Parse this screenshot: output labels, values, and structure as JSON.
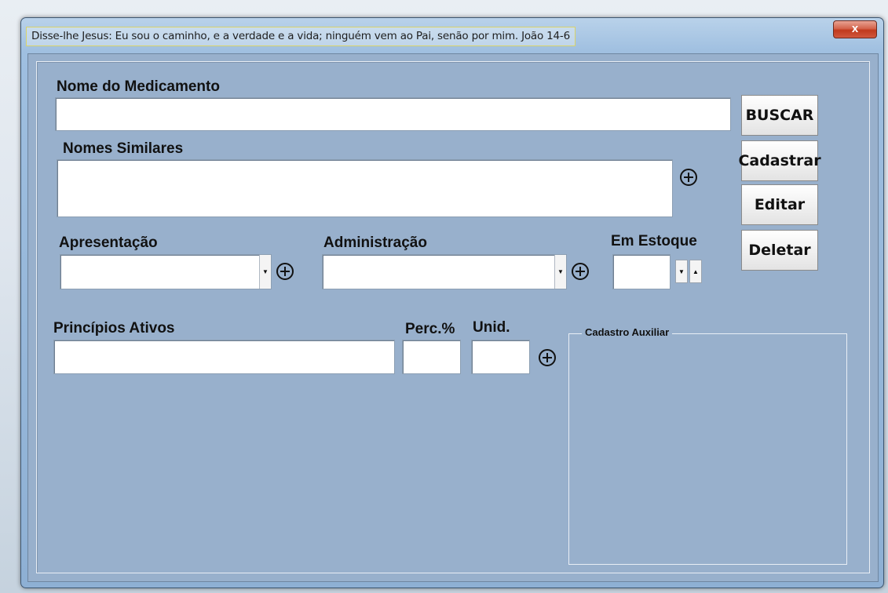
{
  "window": {
    "title": "Disse-lhe Jesus: Eu sou o caminho, e a verdade e a vida; ninguém vem ao Pai, senão por mim. João 14-6",
    "close_label": "x"
  },
  "form": {
    "nome_label": "Nome do Medicamento",
    "similares_label": "Nomes Similares",
    "apresentacao_label": "Apresentação",
    "administracao_label": "Administração",
    "estoque_label": "Em Estoque",
    "principios_label": "Princípios Ativos",
    "perc_label": "Perc.%",
    "unid_label": "Unid.",
    "nome_value": "",
    "similares_value": "",
    "apresentacao_value": "",
    "administracao_value": "",
    "estoque_value": "",
    "principios_value": "",
    "perc_value": "",
    "unid_value": ""
  },
  "buttons": {
    "buscar": "BUSCAR",
    "cadastrar": "Cadastrar",
    "editar": "Editar",
    "deletar": "Deletar"
  },
  "group": {
    "title": "Cadastro Auxiliar"
  },
  "icons": {
    "add": "plus-circle-icon",
    "combo": "chevron-down-icon",
    "spin_down": "chevron-down-icon",
    "spin_up": "chevron-up-icon"
  },
  "colors": {
    "client_bg": "#98b0cc",
    "close_red": "#c0391c"
  }
}
